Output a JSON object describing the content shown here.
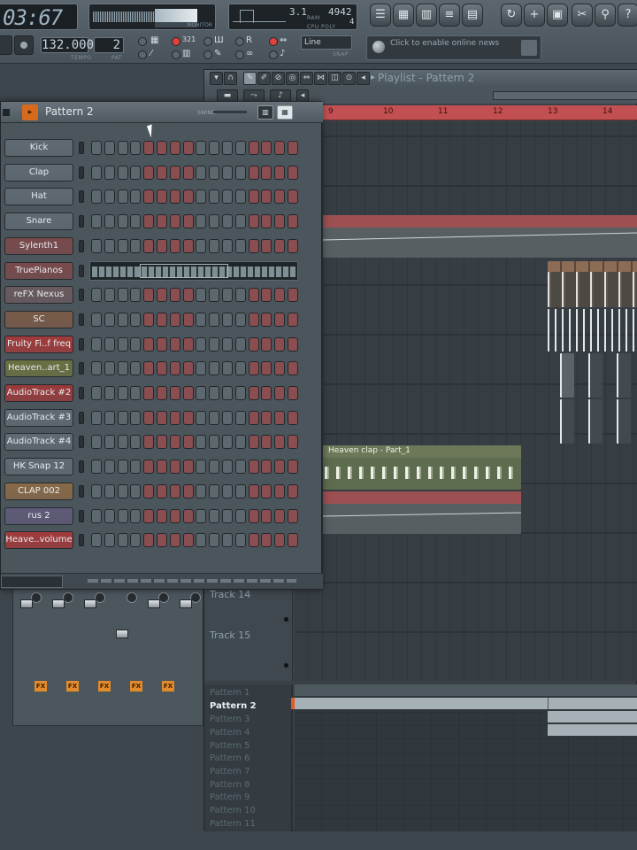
{
  "toolbar": {
    "time_main": "03:67",
    "time_prefix": "-:",
    "tempo_value": "132.000",
    "tempo_label": "TEMPO",
    "pattern_value": "2",
    "pattern_label": "PAT",
    "monitor_label": "MONITOR",
    "cpu_readout_1": "3.1",
    "cpu_readout_2": "4942",
    "cpu_readout_3": "4",
    "ram_label": "RAM",
    "cpu_label": "CPU",
    "poly_label": "POLY",
    "snap_value": "Line",
    "snap_label": "SNAP",
    "news_text": "Click to enable online news"
  },
  "playlist": {
    "title": "Playlist - Pattern 2",
    "ruler": [
      "9",
      "10",
      "11",
      "12",
      "13",
      "14"
    ],
    "clip_label": "Heaven clap - Part_1",
    "tracks": [
      "Track 14",
      "Track 15"
    ],
    "patterns": [
      "Pattern 1",
      "Pattern 2",
      "Pattern 3",
      "Pattern 4",
      "Pattern 5",
      "Pattern 6",
      "Pattern 7",
      "Pattern 8",
      "Pattern 9",
      "Pattern 10",
      "Pattern 11"
    ],
    "selected_pattern": "Pattern 2"
  },
  "rack": {
    "title": "Pattern 2",
    "swing_label": "SWING",
    "channels": [
      {
        "name": "Kick",
        "color": "#5f6a72"
      },
      {
        "name": "Clap",
        "color": "#5f6a72"
      },
      {
        "name": "Hat",
        "color": "#5f6a72"
      },
      {
        "name": "Snare",
        "color": "#5f6a72"
      },
      {
        "name": "Sylenth1",
        "color": "#7a4a4c"
      },
      {
        "name": "TruePianos",
        "color": "#7a4a4c"
      },
      {
        "name": "reFX Nexus",
        "color": "#6a5a5e"
      },
      {
        "name": "SC",
        "color": "#7a5a48"
      },
      {
        "name": "Fruity Fi..f freq",
        "color": "#a23a3a"
      },
      {
        "name": "Heaven..art_1",
        "color": "#6b7040"
      },
      {
        "name": "AudioTrack #2",
        "color": "#9a3a3a"
      },
      {
        "name": "AudioTrack #3",
        "color": "#5f6a72"
      },
      {
        "name": "AudioTrack #4",
        "color": "#5f6a72"
      },
      {
        "name": "HK Snap 12",
        "color": "#5f6a72"
      },
      {
        "name": "CLAP 002",
        "color": "#8a6a48"
      },
      {
        "name": "rus 2",
        "color": "#5f5a78"
      },
      {
        "name": "Heave..volume",
        "color": "#a23a3a"
      }
    ]
  },
  "mixer": {
    "fx_label": "FX"
  }
}
